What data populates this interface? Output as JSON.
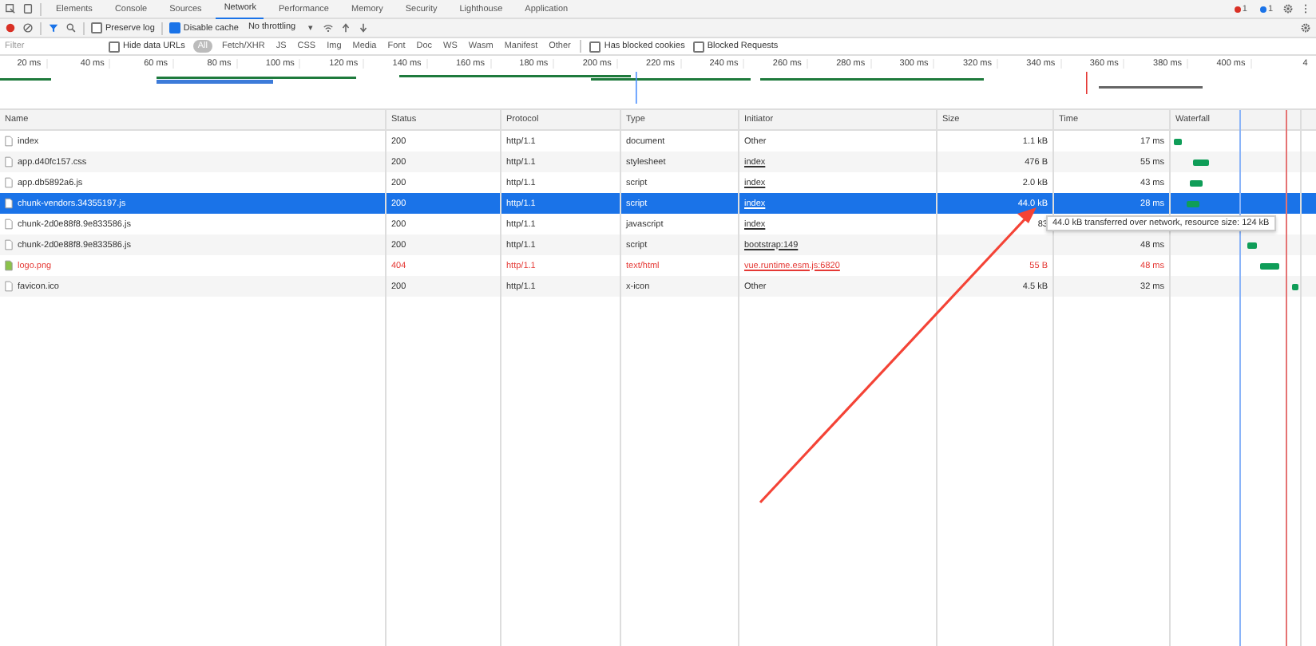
{
  "tabs": [
    {
      "label": "Elements",
      "selected": false
    },
    {
      "label": "Console",
      "selected": false
    },
    {
      "label": "Sources",
      "selected": false
    },
    {
      "label": "Network",
      "selected": true
    },
    {
      "label": "Performance",
      "selected": false
    },
    {
      "label": "Memory",
      "selected": false
    },
    {
      "label": "Security",
      "selected": false
    },
    {
      "label": "Lighthouse",
      "selected": false
    },
    {
      "label": "Application",
      "selected": false
    }
  ],
  "badges": [
    {
      "count": "1",
      "color": "#d93025"
    },
    {
      "count": "1",
      "color": "#1a73e8"
    }
  ],
  "toolbar": {
    "preserve_log": {
      "label": "Preserve log",
      "checked": false
    },
    "disable_cache": {
      "label": "Disable cache",
      "checked": true
    },
    "throttling": "No throttling",
    "caret": "▾"
  },
  "filter": {
    "placeholder": "Filter",
    "hide_data_urls": {
      "label": "Hide data URLs",
      "checked": false
    },
    "types": [
      {
        "label": "All",
        "selected": true
      },
      {
        "label": "Fetch/XHR",
        "selected": false
      },
      {
        "label": "JS",
        "selected": false
      },
      {
        "label": "CSS",
        "selected": false
      },
      {
        "label": "Img",
        "selected": false
      },
      {
        "label": "Media",
        "selected": false
      },
      {
        "label": "Font",
        "selected": false
      },
      {
        "label": "Doc",
        "selected": false
      },
      {
        "label": "WS",
        "selected": false
      },
      {
        "label": "Wasm",
        "selected": false
      },
      {
        "label": "Manifest",
        "selected": false
      },
      {
        "label": "Other",
        "selected": false
      }
    ],
    "blocked_cookies": {
      "label": "Has blocked cookies",
      "checked": false
    },
    "blocked_requests": {
      "label": "Blocked Requests",
      "checked": false
    }
  },
  "overview": {
    "ticks": [
      "20 ms",
      "40 ms",
      "60 ms",
      "80 ms",
      "100 ms",
      "120 ms",
      "140 ms",
      "160 ms",
      "180 ms",
      "200 ms",
      "220 ms",
      "240 ms",
      "260 ms",
      "280 ms",
      "300 ms",
      "320 ms",
      "340 ms",
      "360 ms",
      "380 ms",
      "400 ms",
      "4"
    ]
  },
  "table": {
    "columns": [
      "Name",
      "Status",
      "Protocol",
      "Type",
      "Initiator",
      "Size",
      "Time",
      "Waterfall"
    ],
    "rows": [
      {
        "name": "index",
        "status": "200",
        "protocol": "http/1.1",
        "type": "document",
        "initiator": "Other",
        "initiator_link": false,
        "size": "1.1 kB",
        "time": "17 ms",
        "selected": false,
        "error": false
      },
      {
        "name": "app.d40fc157.css",
        "status": "200",
        "protocol": "http/1.1",
        "type": "stylesheet",
        "initiator": "index",
        "initiator_link": true,
        "size": "476 B",
        "time": "55 ms",
        "selected": false,
        "error": false
      },
      {
        "name": "app.db5892a6.js",
        "status": "200",
        "protocol": "http/1.1",
        "type": "script",
        "initiator": "index",
        "initiator_link": true,
        "size": "2.0 kB",
        "time": "43 ms",
        "selected": false,
        "error": false
      },
      {
        "name": "chunk-vendors.34355197.js",
        "status": "200",
        "protocol": "http/1.1",
        "type": "script",
        "initiator": "index",
        "initiator_link": true,
        "size": "44.0 kB",
        "time": "28 ms",
        "selected": true,
        "error": false
      },
      {
        "name": "chunk-2d0e88f8.9e833586.js",
        "status": "200",
        "protocol": "http/1.1",
        "type": "javascript",
        "initiator": "index",
        "initiator_link": true,
        "size": "83",
        "selected": false,
        "error": false
      },
      {
        "name": "chunk-2d0e88f8.9e833586.js",
        "status": "200",
        "protocol": "http/1.1",
        "type": "script",
        "initiator": "bootstrap:149",
        "initiator_link": true,
        "time": "48 ms",
        "selected": false,
        "error": false
      },
      {
        "name": "logo.png",
        "status": "404",
        "protocol": "http/1.1",
        "type": "text/html",
        "initiator": "vue.runtime.esm.js:6820",
        "initiator_link": true,
        "size": "55 B",
        "time": "48 ms",
        "selected": false,
        "error": true
      },
      {
        "name": "favicon.ico",
        "status": "200",
        "protocol": "http/1.1",
        "type": "x-icon",
        "initiator": "Other",
        "initiator_link": false,
        "size": "4.5 kB",
        "time": "32 ms",
        "selected": false,
        "error": false
      }
    ]
  },
  "tooltip": "44.0 kB transferred over network, resource size: 124 kB"
}
